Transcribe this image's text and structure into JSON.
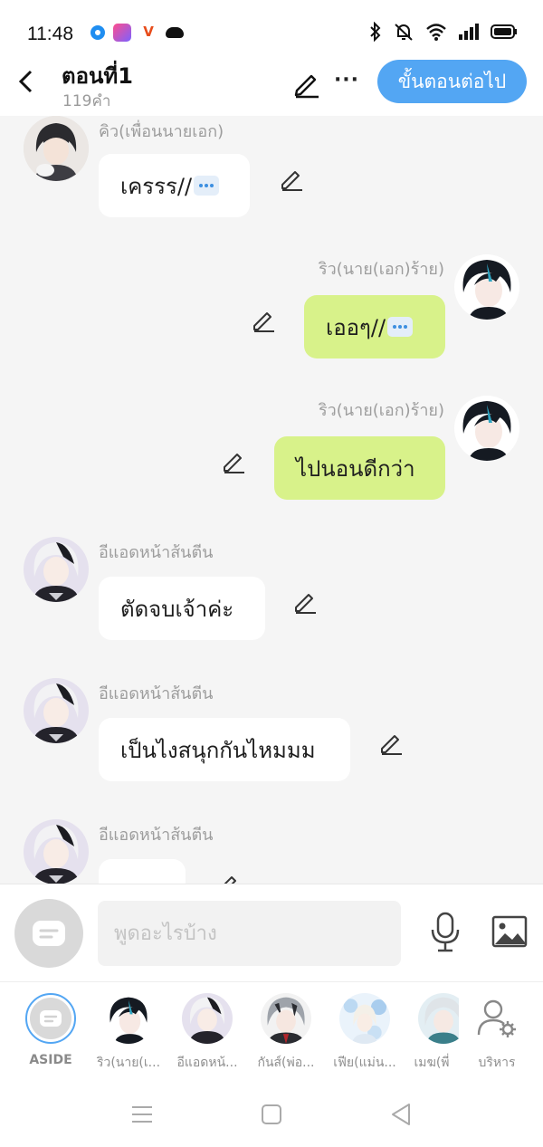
{
  "status_bar": {
    "time": "11:48"
  },
  "header": {
    "title": "ตอนที่1",
    "word_count": "119คำ",
    "next_button": "ขั้นตอนต่อไป",
    "more_label": "···"
  },
  "messages": [
    {
      "side": "left",
      "name": "คิว(เพื่อนนายเอก)",
      "text": "เครรร//",
      "avatar": "dark-hair-boy-with-cat"
    },
    {
      "side": "right",
      "name": "ริว(นาย(เอก)ร้าย)",
      "text": "เออๆ//",
      "avatar": "black-blue-hair-boy"
    },
    {
      "side": "right",
      "name": "ริว(นาย(เอก)ร้าย)",
      "text": "ไปนอนดีกว่า",
      "avatar": "black-blue-hair-boy"
    },
    {
      "side": "left",
      "name": "อีแอดหน้าส้นตีน",
      "text": "ตัดจบเจ้าค่ะ",
      "avatar": "white-black-hair-girl"
    },
    {
      "side": "left",
      "name": "อีแอดหน้าส้นตีน",
      "text": "เป็นไงสนุกกันไหมมม",
      "avatar": "white-black-hair-girl"
    },
    {
      "side": "left",
      "name": "อีแอดหน้าส้นตีน",
      "text": "",
      "avatar": "white-black-hair-girl"
    }
  ],
  "input": {
    "placeholder": "พูดอะไรบ้าง"
  },
  "characters": [
    {
      "label": "ASIDE"
    },
    {
      "label": "ริว(นาย(เ..."
    },
    {
      "label": "อีแอดหน้..."
    },
    {
      "label": "กันส์(พ่อ..."
    },
    {
      "label": "เฟีย(แม่น..."
    },
    {
      "label": "เมฆ(พี่"
    },
    {
      "label": "บริหาร"
    }
  ],
  "colors": {
    "accent": "#53a6f3",
    "right_bubble": "#d8f28a",
    "chat_bg": "#f5f5f5"
  }
}
